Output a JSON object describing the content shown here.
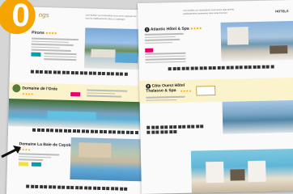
{
  "badge": {
    "number": "0"
  },
  "left_page": {
    "header_title": "ngs",
    "header_blurb_line1": "pour faciliter vos réservations nous avons regroupé les",
    "header_blurb_line2": "tous les établissements dans ce catalogue",
    "hotel1": {
      "name": "Pirons",
      "stars": "★★★★"
    },
    "hotel2": {
      "name": "Domaine de l'Orée",
      "stars": "★★★★"
    },
    "hotel3": {
      "name": "Domaine La Baie de Cayola",
      "stars": "★★★★"
    }
  },
  "right_page": {
    "section_label": "HOTELS",
    "intro_line1": "Pour faciliter vos réservations nous avons regroupé les",
    "intro_line2": "établissements partenaires dans cette brochure",
    "hotel1": {
      "number": "1",
      "name": "Atlantic Hôtel & Spa",
      "stars": "★★★★"
    },
    "hotel2": {
      "number": "2",
      "name_line1": "Côte Ouest Hôtel",
      "name_line2": "Thalasso & Spa",
      "stars": "★★★★"
    }
  },
  "colors": {
    "accent_orange": "#f5a400",
    "accent_pink": "#e6006e",
    "accent_teal": "#00a0b0",
    "accent_yellow": "#f0e040"
  },
  "icons": [
    "arrow-icon",
    "amenity-icons"
  ]
}
